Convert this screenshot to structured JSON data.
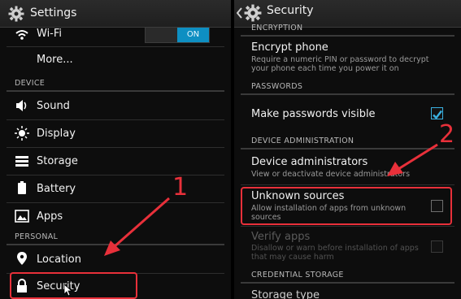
{
  "left": {
    "title": "Settings",
    "wifi_label": "Wi-Fi",
    "wifi_toggle": "ON",
    "more_label": "More...",
    "device_header": "DEVICE",
    "device_items": [
      "Sound",
      "Display",
      "Storage",
      "Battery",
      "Apps"
    ],
    "personal_header": "PERSONAL",
    "location_label": "Location",
    "security_label": "Security"
  },
  "right": {
    "title": "Security",
    "encryption_header": "ENCRYPTION",
    "encrypt_title": "Encrypt phone",
    "encrypt_sub": "Require a numeric PIN or password to decrypt your phone each time you power it on",
    "passwords_header": "PASSWORDS",
    "make_visible": "Make passwords visible",
    "make_visible_checked": true,
    "device_admin_header": "DEVICE ADMINISTRATION",
    "device_admins_title": "Device administrators",
    "device_admins_sub": "View or deactivate device administrators",
    "unknown_title": "Unknown sources",
    "unknown_sub": "Allow installation of apps from unknown sources",
    "unknown_checked": false,
    "verify_title": "Verify apps",
    "verify_sub": "Disallow or warn before installation of apps that may cause harm",
    "credential_header": "CREDENTIAL STORAGE",
    "storage_type": "Storage type"
  },
  "annotations": {
    "step1": "1",
    "step2": "2",
    "color": "#e8303a"
  },
  "colors": {
    "accent": "#0e8fc2",
    "background": "#0d0d0d"
  }
}
